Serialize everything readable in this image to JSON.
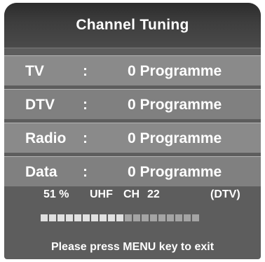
{
  "title": "Channel Tuning",
  "rows": [
    {
      "label": "TV",
      "separator": ":",
      "value": "0 Programme"
    },
    {
      "label": "DTV",
      "separator": ":",
      "value": "0 Programme"
    },
    {
      "label": "Radio",
      "separator": ":",
      "value": "0 Programme"
    },
    {
      "label": "Data",
      "separator": ":",
      "value": "0 Programme"
    }
  ],
  "status": {
    "percent": "51 %",
    "band": "UHF",
    "channel_label": "CH",
    "channel": "22",
    "mode": "(DTV)"
  },
  "progress": {
    "fraction": 0.51,
    "segments": 19
  },
  "footer": "Please press MENU key to exit",
  "colors": {
    "panel": "#5d5d5d",
    "row": "#8a8a8a",
    "text": "#ffffff"
  }
}
